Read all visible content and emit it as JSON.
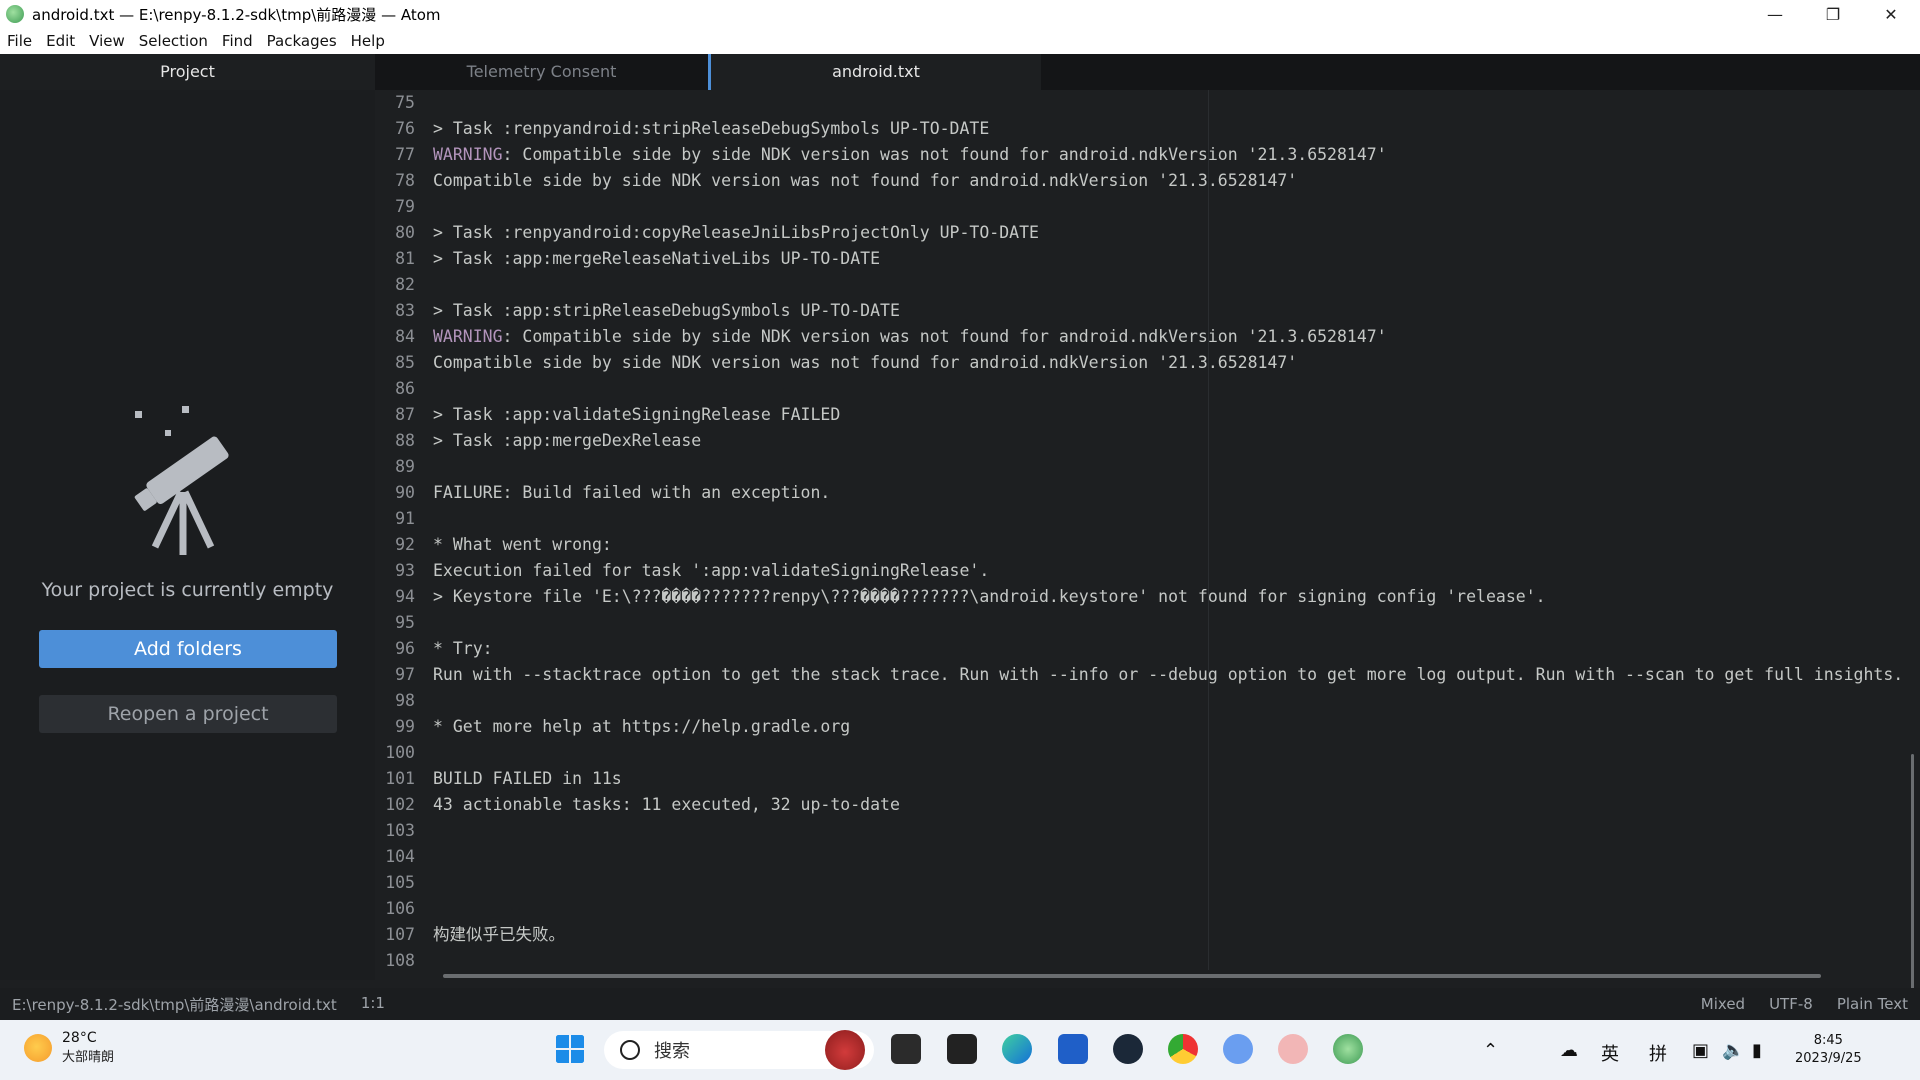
{
  "window": {
    "title": "android.txt — E:\\renpy-8.1.2-sdk\\tmp\\前路漫漫 — Atom"
  },
  "menu": [
    "File",
    "Edit",
    "View",
    "Selection",
    "Find",
    "Packages",
    "Help"
  ],
  "sidebar": {
    "tab": "Project",
    "empty_message": "Your project is currently empty",
    "add_folders": "Add folders",
    "reopen": "Reopen a project"
  },
  "tabs": [
    "Telemetry Consent",
    "android.txt"
  ],
  "editor": {
    "lines": [
      {
        "n": "75",
        "pre": "",
        "text": ""
      },
      {
        "n": "76",
        "pre": "",
        "text": "> Task :renpyandroid:stripReleaseDebugSymbols UP-TO-DATE"
      },
      {
        "n": "77",
        "pre": "WARNING",
        "text": ": Compatible side by side NDK version was not found for android.ndkVersion '21.3.6528147'"
      },
      {
        "n": "78",
        "pre": "",
        "text": "Compatible side by side NDK version was not found for android.ndkVersion '21.3.6528147'"
      },
      {
        "n": "79",
        "pre": "",
        "text": ""
      },
      {
        "n": "80",
        "pre": "",
        "text": "> Task :renpyandroid:copyReleaseJniLibsProjectOnly UP-TO-DATE"
      },
      {
        "n": "81",
        "pre": "",
        "text": "> Task :app:mergeReleaseNativeLibs UP-TO-DATE"
      },
      {
        "n": "82",
        "pre": "",
        "text": ""
      },
      {
        "n": "83",
        "pre": "",
        "text": "> Task :app:stripReleaseDebugSymbols UP-TO-DATE"
      },
      {
        "n": "84",
        "pre": "WARNING",
        "text": ": Compatible side by side NDK version was not found for android.ndkVersion '21.3.6528147'"
      },
      {
        "n": "85",
        "pre": "",
        "text": "Compatible side by side NDK version was not found for android.ndkVersion '21.3.6528147'"
      },
      {
        "n": "86",
        "pre": "",
        "text": ""
      },
      {
        "n": "87",
        "pre": "",
        "text": "> Task :app:validateSigningRelease FAILED"
      },
      {
        "n": "88",
        "pre": "",
        "text": "> Task :app:mergeDexRelease"
      },
      {
        "n": "89",
        "pre": "",
        "text": ""
      },
      {
        "n": "90",
        "pre": "",
        "text": "FAILURE: Build failed with an exception."
      },
      {
        "n": "91",
        "pre": "",
        "text": ""
      },
      {
        "n": "92",
        "pre": "",
        "text": "* What went wrong:"
      },
      {
        "n": "93",
        "pre": "",
        "text": "Execution failed for task ':app:validateSigningRelease'."
      },
      {
        "n": "94",
        "pre": "",
        "text": "> Keystore file 'E:\\???����???????renpy\\???����???????\\android.keystore' not found for signing config 'release'."
      },
      {
        "n": "95",
        "pre": "",
        "text": ""
      },
      {
        "n": "96",
        "pre": "",
        "text": "* Try:"
      },
      {
        "n": "97",
        "pre": "",
        "text": "Run with --stacktrace option to get the stack trace. Run with --info or --debug option to get more log output. Run with --scan to get full insights."
      },
      {
        "n": "98",
        "pre": "",
        "text": ""
      },
      {
        "n": "99",
        "pre": "",
        "text": "* Get more help at https://help.gradle.org"
      },
      {
        "n": "100",
        "pre": "",
        "text": ""
      },
      {
        "n": "101",
        "pre": "",
        "text": "BUILD FAILED in 11s"
      },
      {
        "n": "102",
        "pre": "",
        "text": "43 actionable tasks: 11 executed, 32 up-to-date"
      },
      {
        "n": "103",
        "pre": "",
        "text": ""
      },
      {
        "n": "104",
        "pre": "",
        "text": ""
      },
      {
        "n": "105",
        "pre": "",
        "text": ""
      },
      {
        "n": "106",
        "pre": "",
        "text": ""
      },
      {
        "n": "107",
        "pre": "",
        "text": "构建似乎已失败。"
      },
      {
        "n": "108",
        "pre": "",
        "text": ""
      }
    ]
  },
  "status": {
    "path": "E:\\renpy-8.1.2-sdk\\tmp\\前路漫漫\\android.txt",
    "cursor": "1:1",
    "line_ending": "Mixed",
    "encoding": "UTF-8",
    "grammar": "Plain Text"
  },
  "taskbar": {
    "temp": "28°C",
    "weather": "大部晴朗",
    "search": "搜索",
    "ime_lang": "英",
    "ime_mode": "拼",
    "time": "8:45",
    "date": "2023/9/25"
  },
  "colors": {
    "accent": "#4d8fd8",
    "warning": "#b294bb",
    "editor_bg": "#1d1f21"
  }
}
